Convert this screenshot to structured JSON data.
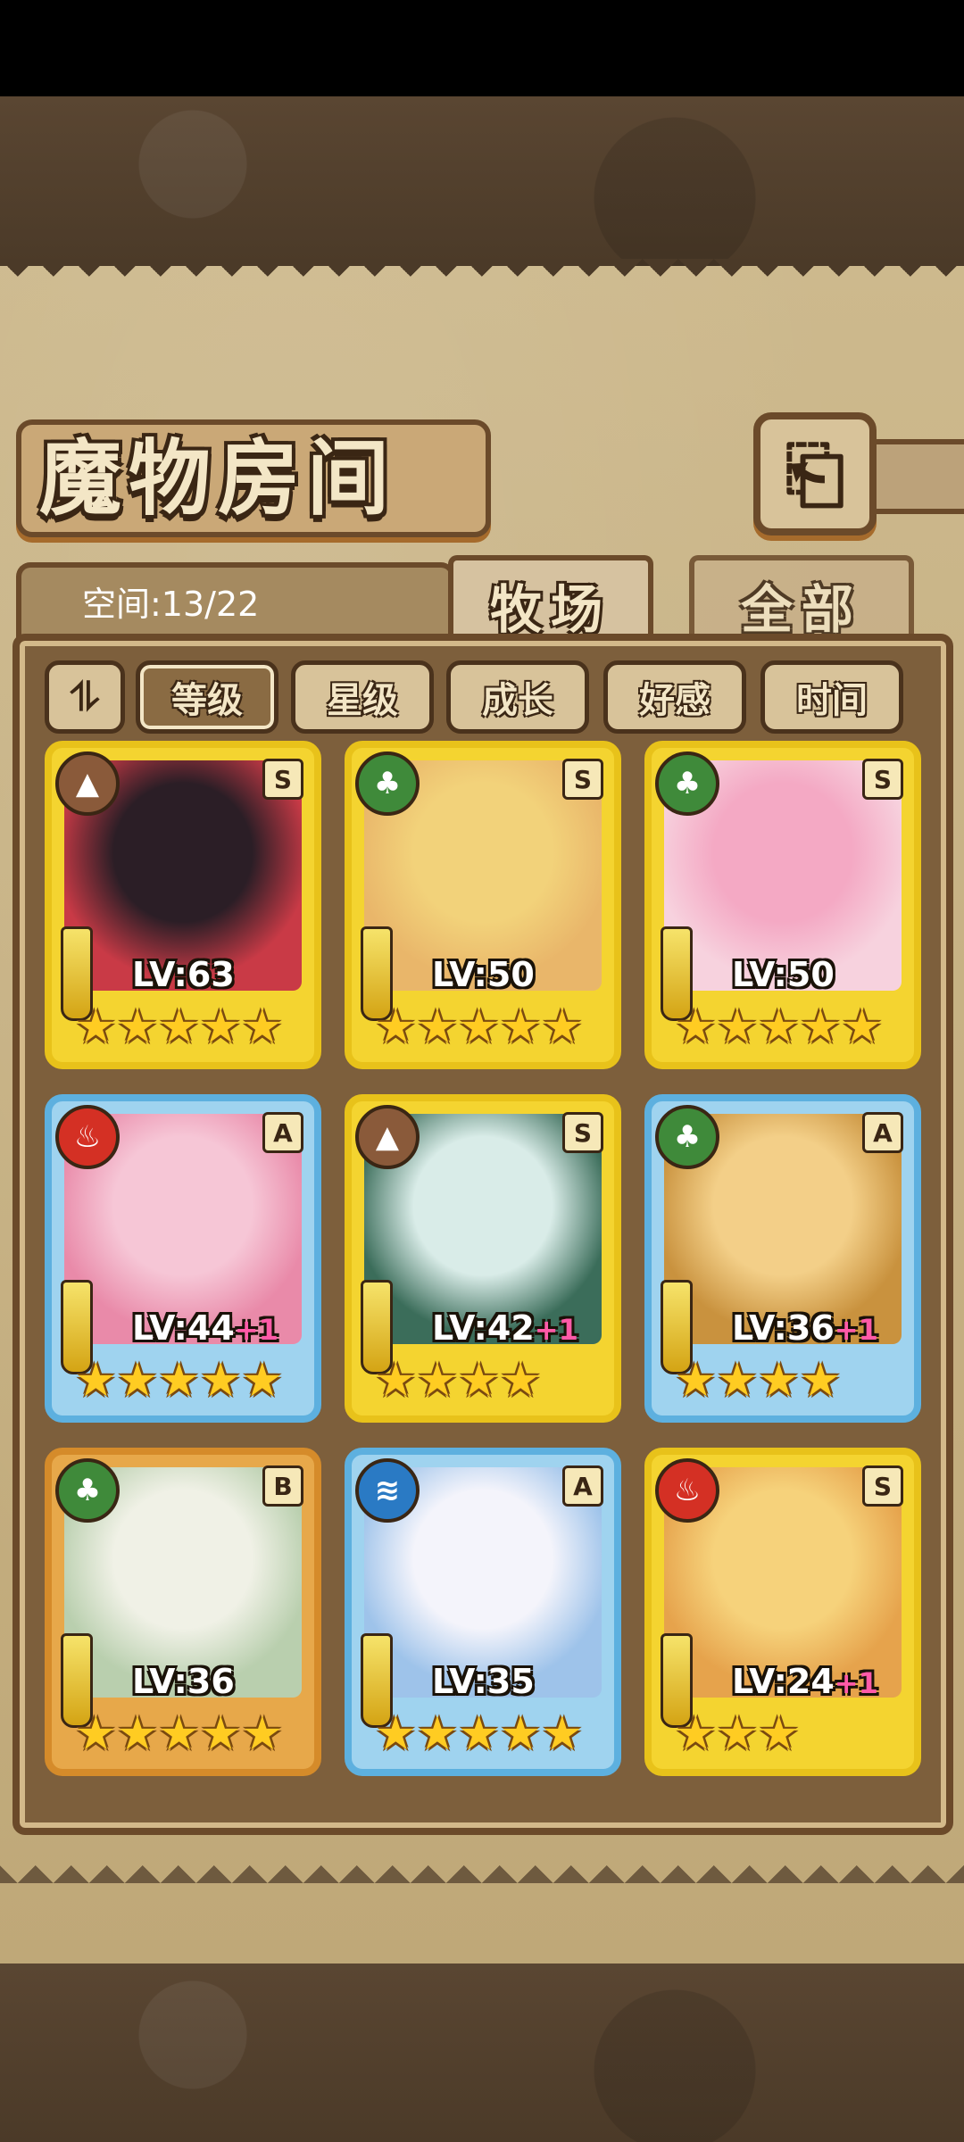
{
  "header": {
    "title": "魔物房间",
    "back_icon": "⎗"
  },
  "space": {
    "label": "空间:13/22"
  },
  "tabs": [
    {
      "label": "牧场",
      "active": true
    },
    {
      "label": "全部",
      "active": false
    }
  ],
  "sort": {
    "toggle_glyph": "⥮",
    "filters": [
      {
        "label": "等级",
        "active": true
      },
      {
        "label": "星级",
        "active": false
      },
      {
        "label": "成长",
        "active": false
      },
      {
        "label": "好感",
        "active": false
      },
      {
        "label": "时间",
        "active": false
      }
    ]
  },
  "monsters": [
    {
      "element": "earth",
      "element_icon": "▲",
      "rank": "S",
      "level": "LV:63",
      "plus": "",
      "stars": "★★★★★",
      "frame": "gold",
      "portrait_colors": [
        "#2b1e26",
        "#c93a46"
      ]
    },
    {
      "element": "grass",
      "element_icon": "♣",
      "rank": "S",
      "level": "LV:50",
      "plus": "",
      "stars": "★★★★★",
      "frame": "gold",
      "portrait_colors": [
        "#f2d27a",
        "#e9b66a"
      ]
    },
    {
      "element": "grass",
      "element_icon": "♣",
      "rank": "S",
      "level": "LV:50",
      "plus": "",
      "stars": "★★★★★",
      "frame": "gold",
      "portrait_colors": [
        "#f4a9c4",
        "#f7d2de"
      ]
    },
    {
      "element": "fire",
      "element_icon": "♨",
      "rank": "A",
      "level": "LV:44",
      "plus": "+1",
      "stars": "★★★★★",
      "frame": "blue",
      "portrait_colors": [
        "#f6c6d6",
        "#e98aa9"
      ]
    },
    {
      "element": "earth",
      "element_icon": "▲",
      "rank": "S",
      "level": "LV:42",
      "plus": "+1",
      "stars": "★★★★",
      "frame": "gold",
      "portrait_colors": [
        "#d9ece8",
        "#3b6d5a"
      ]
    },
    {
      "element": "grass",
      "element_icon": "♣",
      "rank": "A",
      "level": "LV:36",
      "plus": "+1",
      "stars": "★★★★",
      "frame": "blue",
      "portrait_colors": [
        "#f3cf88",
        "#c9923e"
      ]
    },
    {
      "element": "grass",
      "element_icon": "♣",
      "rank": "B",
      "level": "LV:36",
      "plus": "",
      "stars": "★★★★★",
      "frame": "bronze",
      "portrait_colors": [
        "#f0f1e6",
        "#b9cfae"
      ]
    },
    {
      "element": "water",
      "element_icon": "≋",
      "rank": "A",
      "level": "LV:35",
      "plus": "",
      "stars": "★★★★★",
      "frame": "blue",
      "portrait_colors": [
        "#f4f4fb",
        "#9ec3ea"
      ]
    },
    {
      "element": "fire",
      "element_icon": "♨",
      "rank": "S",
      "level": "LV:24",
      "plus": "+1",
      "stars": "★★★",
      "frame": "gold",
      "portrait_colors": [
        "#f6d27b",
        "#e6a34c"
      ]
    }
  ]
}
